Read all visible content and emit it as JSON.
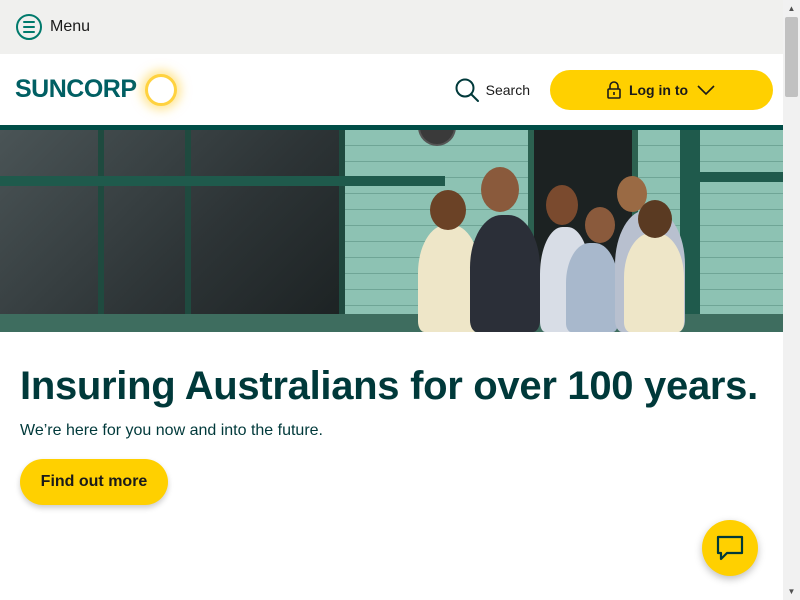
{
  "utility_bar": {
    "menu_label": "Menu",
    "menu_icon": "hamburger-circle-icon"
  },
  "header": {
    "logo_text": "SUNCORP",
    "logo_icon": "sun-icon",
    "search_label": "Search",
    "search_icon": "search-icon",
    "login_label": "Log in to",
    "login_icon": "lock-icon",
    "login_chevron": "chevron-down-icon"
  },
  "hero": {
    "image_description_icon": "family-photo"
  },
  "content": {
    "headline": "Insuring Australians for over 100 years.",
    "subtitle": "We’re here for you now and into the future.",
    "cta_label": "Find out more"
  },
  "chat": {
    "icon": "chat-bubble-icon"
  },
  "colors": {
    "brand_teal": "#00393a",
    "accent_teal": "#007a6c",
    "brand_yellow": "#ffd000",
    "header_rule": "#004d47",
    "utility_bg": "#f0f0ee"
  }
}
